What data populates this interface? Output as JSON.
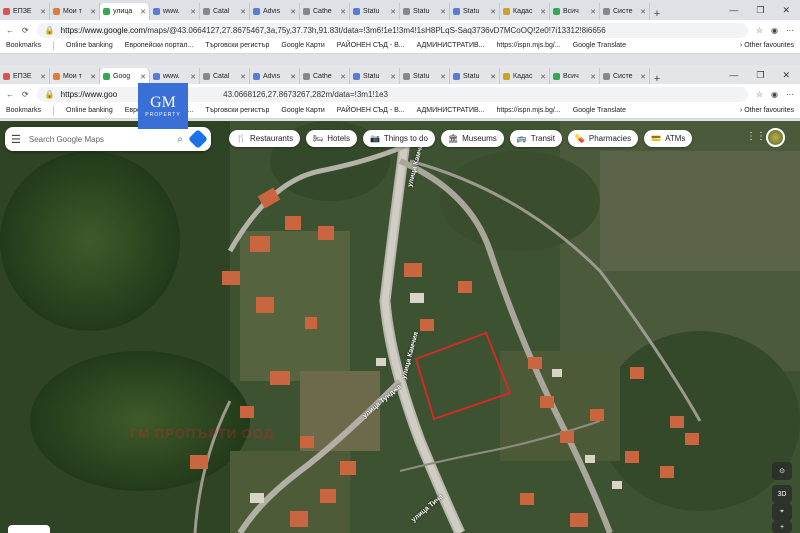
{
  "browser_back": {
    "tabs": [
      {
        "label": "ЕПЗЕ",
        "color": "#d9534f"
      },
      {
        "label": "Мои т",
        "color": "#e07b39"
      },
      {
        "label": "улица",
        "color": "#34a853",
        "active": true
      },
      {
        "label": "www.",
        "color": "#5b7bd6"
      },
      {
        "label": "Catal",
        "color": "#888888"
      },
      {
        "label": "Advis",
        "color": "#5b7bd6"
      },
      {
        "label": "Cathe",
        "color": "#888888"
      },
      {
        "label": "Statu",
        "color": "#5b7bd6"
      },
      {
        "label": "Statu",
        "color": "#888888"
      },
      {
        "label": "Statu",
        "color": "#5b7bd6"
      },
      {
        "label": "Кадас",
        "color": "#c9a227"
      },
      {
        "label": "Всич",
        "color": "#34a853"
      },
      {
        "label": "Систе",
        "color": "#888888"
      }
    ],
    "url_prefix": "https://www.google.com",
    "url_rest": "/maps/@43.0664127,27.8675467,3a,75y,37.73h,91.83t/data=!3m6!1e1!3m4!1sH8PLqS-Saq3736vD7MCoOQ!2e0!7i13312!8i6656"
  },
  "browser_front": {
    "tabs": [
      {
        "label": "ЕПЗЕ",
        "color": "#d9534f"
      },
      {
        "label": "Мои т",
        "color": "#e07b39"
      },
      {
        "label": "Goog",
        "color": "#34a853",
        "active": true
      },
      {
        "label": "www.",
        "color": "#5b7bd6"
      },
      {
        "label": "Catal",
        "color": "#888888"
      },
      {
        "label": "Advis",
        "color": "#5b7bd6"
      },
      {
        "label": "Cathe",
        "color": "#888888"
      },
      {
        "label": "Statu",
        "color": "#5b7bd6"
      },
      {
        "label": "Statu",
        "color": "#888888"
      },
      {
        "label": "Statu",
        "color": "#5b7bd6"
      },
      {
        "label": "Кадас",
        "color": "#c9a227"
      },
      {
        "label": "Всич",
        "color": "#34a853"
      },
      {
        "label": "Систе",
        "color": "#888888"
      }
    ],
    "url_prefix": "https://www.goo",
    "url_rest": "43.0668126,27.8673267,282m/data=!3m1!1e3"
  },
  "bookmarks": {
    "items": [
      "Bookmarks",
      "Online banking",
      "Европейски портал...",
      "Търговски регистър",
      "Google Карти",
      "РАЙОНЕН СЪД - В...",
      "АДМИНИСТРАТИВ...",
      "https://ispn.mjs.bg/...",
      "Google Translate"
    ],
    "other": "Other favourites"
  },
  "logo": {
    "main": "GM",
    "sub": "PROPERTY"
  },
  "search": {
    "placeholder": "Search Google Maps"
  },
  "chips": [
    {
      "label": "Restaurants",
      "icon": "🍴"
    },
    {
      "label": "Hotels",
      "icon": "🛏"
    },
    {
      "label": "Things to do",
      "icon": "📷"
    },
    {
      "label": "Museums",
      "icon": "🏛"
    },
    {
      "label": "Transit",
      "icon": "🚌"
    },
    {
      "label": "Pharmacies",
      "icon": "💊"
    },
    {
      "label": "ATMs",
      "icon": "💳"
    }
  ],
  "map": {
    "road_labels": [
      "улица Камчия",
      "улица Камчия",
      "улица Тунджа",
      "улица Тича"
    ],
    "watermark": "ГМ ПРОПЪРТИ ООД",
    "controls": [
      "⊙",
      "3D",
      "⌖",
      "+"
    ],
    "plot_outline_color": "#d12a2a"
  }
}
